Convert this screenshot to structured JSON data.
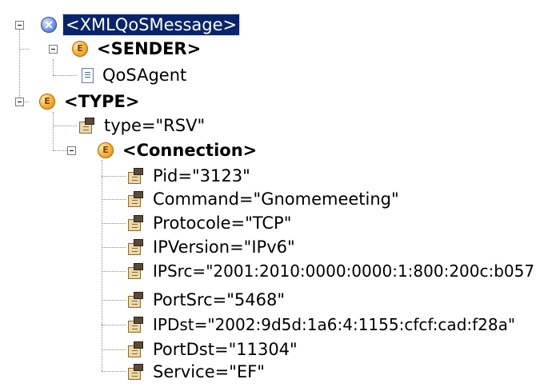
{
  "tree": {
    "root": {
      "label": "<XMLQoSMessage>",
      "icon": "xml-root-icon"
    },
    "sender": {
      "label": "<SENDER>",
      "icon_letter": "E",
      "children": [
        {
          "label": "QoSAgent",
          "icon": "text-node-icon"
        }
      ]
    },
    "type": {
      "label": "<TYPE>",
      "icon_letter": "E",
      "attributes": [
        {
          "label": "type=\"RSV\""
        }
      ],
      "connection": {
        "label": "<Connection>",
        "icon_letter": "E",
        "attributes": [
          {
            "label": "Pid=\"3123\""
          },
          {
            "label": "Command=\"Gnomemeeting\""
          },
          {
            "label": "Protocole=\"TCP\""
          },
          {
            "label": "IPVersion=\"IPv6\""
          },
          {
            "label": "IPSrc=\"2001:2010:0000:0000:1:800:200c:b057\""
          },
          {
            "label": "PortSrc=\"5468\""
          },
          {
            "label": "IPDst=\"2002:9d5d:1a6:4:1155:cfcf:cad:f28a\""
          },
          {
            "label": "PortDst=\"11304\""
          },
          {
            "label": "Service=\"EF\""
          }
        ]
      }
    }
  }
}
